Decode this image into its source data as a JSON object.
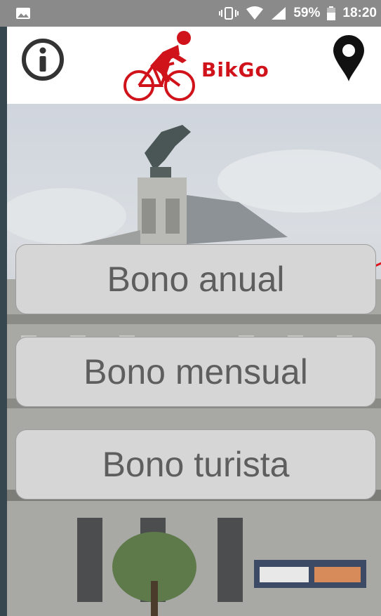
{
  "status_bar": {
    "battery_percent": "59%",
    "time": "18:20",
    "icons": [
      "image-icon",
      "vibrate-icon",
      "wifi-icon",
      "signal-icon",
      "battery-icon"
    ]
  },
  "header": {
    "brand": "BikGo",
    "info_icon": "info-icon",
    "location_icon": "location-pin-icon",
    "brand_color": "#d0121a"
  },
  "menu": {
    "annual_pass": "Bono anual",
    "monthly_pass": "Bono mensual",
    "tourist_pass": "Bono turista"
  }
}
